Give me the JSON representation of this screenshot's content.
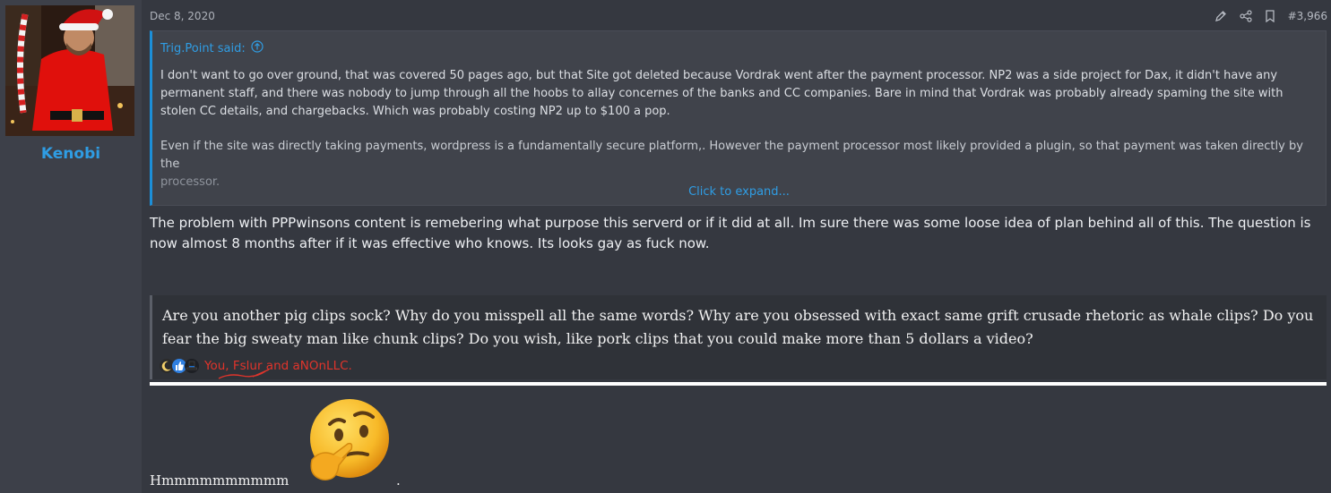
{
  "post": {
    "author": "Kenobi",
    "date": "Dec 8, 2020",
    "number": "#3,966",
    "quote": {
      "attribution": "Trig.Point said:",
      "paragraphs": [
        "I don't want to go over ground, that was covered 50 pages ago, but that Site got deleted because Vordrak went after the payment processor. NP2 was a side project for Dax, it didn't have any permanent staff, and there was nobody to jump through all the hoobs to allay concernes of the banks and CC companies. Bare in mind that Vordrak was probably already spaming the site with stolen CC details, and chargebacks. Which was probably costing NP2 up to $100 a pop.",
        "Even if the site was directly taking payments, wordpress is a fundamentally secure platform,. However the payment processor most likely provided a plugin, so that payment was taken directly by the"
      ],
      "faded_tail": "processor.",
      "expand_label": "Click to expand..."
    },
    "body": "The problem with PPPwinsons content is remebering what purpose this serverd or if it did at all. Im sure there was some loose idea of plan behind all of this. The question is now almost 8 months after if it was effective who knows. Its looks gay as fuck now.",
    "signature": {
      "text": "Are you another pig clips sock? Why do you misspell all the same words? Why are you obsessed with exact same grift crusade rhetoric as whale clips? Do you fear the big sweaty man like chunk clips? Do you wish, like pork clips that you could make more than 5 dollars a video?",
      "reactions_label": "You, Fslur and aNOnLLC.",
      "reaction_icons": [
        "moon-icon",
        "thumbs-up-icon",
        "top-hat-icon"
      ]
    },
    "footer_text": "Hmmmmmmmmmm",
    "footer_period": ".",
    "footer_emoji": "thinking-face-emoji"
  },
  "colors": {
    "accent": "#2f9de4",
    "reaction_text": "#e0342b",
    "background": "#353840"
  }
}
